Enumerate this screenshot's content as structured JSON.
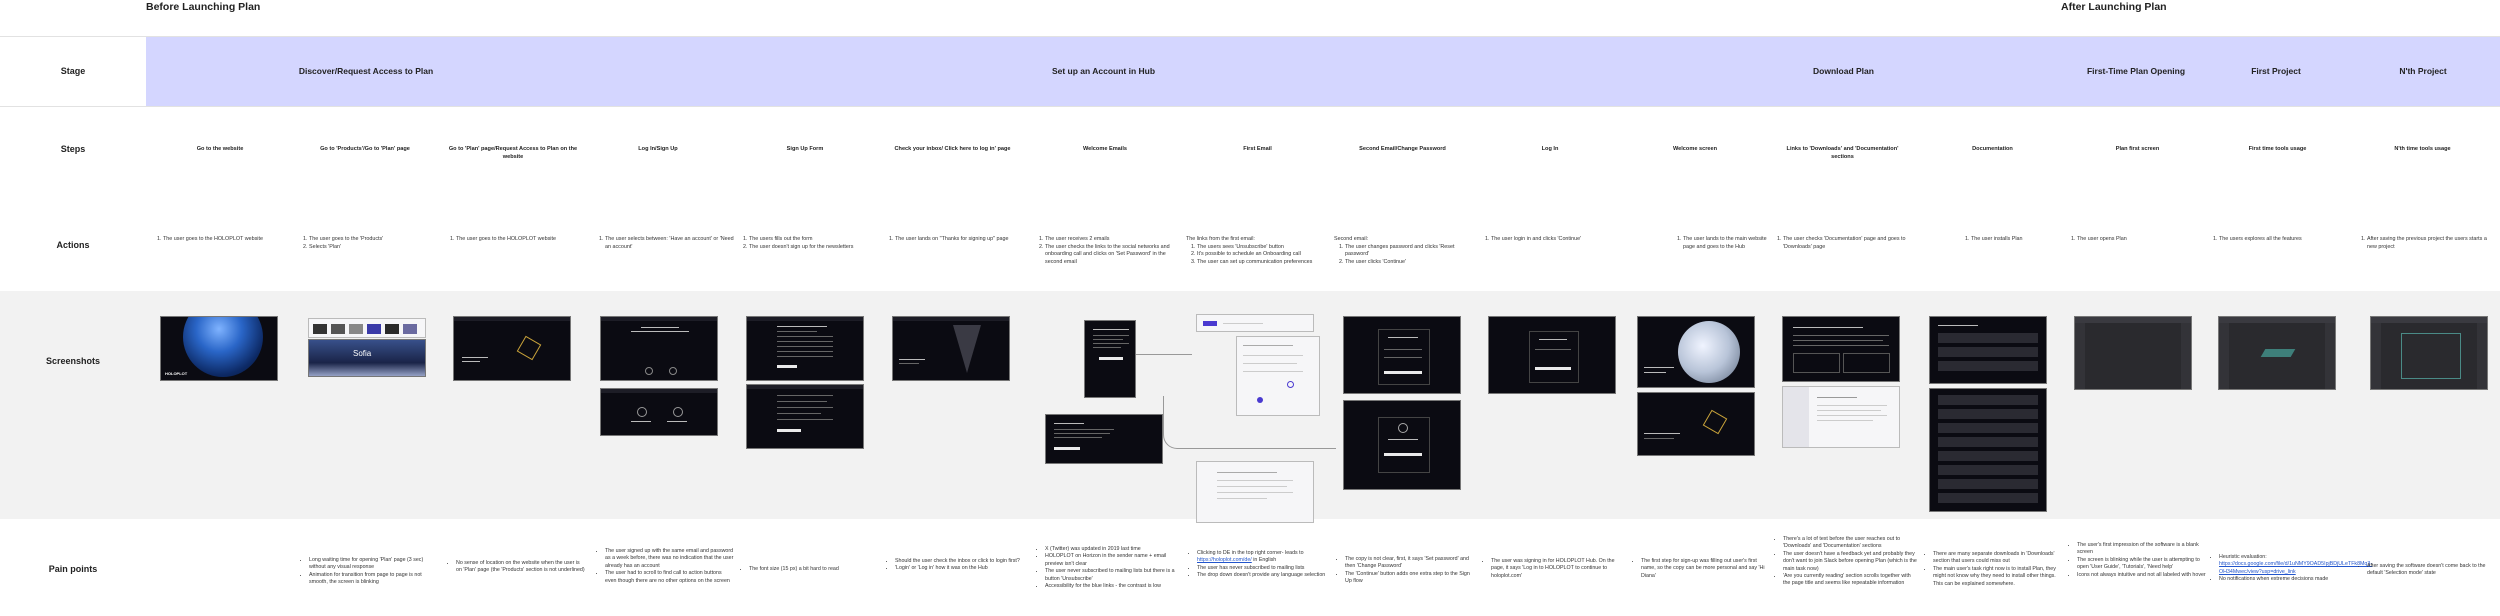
{
  "phases": {
    "before": "Before Launching Plan",
    "after": "After Launching Plan"
  },
  "row_labels": {
    "stage": "Stage",
    "steps": "Steps",
    "actions": "Actions",
    "screenshots": "Screenshots",
    "pain_points": "Pain points"
  },
  "stages": [
    "Discover/Request Access to Plan",
    "Set up an Account in Hub",
    "Download Plan",
    "First-Time Plan Opening",
    "First Project",
    "N'th Project"
  ],
  "steps": [
    "Go to the website",
    "Go to 'Products'/Go to 'Plan' page",
    "Go to 'Plan' page/Request Access to Plan on the website",
    "Log In/Sign Up",
    "Sign Up Form",
    "Check your inbox/ Click here to log in' page",
    "Welcome Emails",
    "First Email",
    "Second Email/Change Password",
    "Log In",
    "Welcome screen",
    "Links to 'Downloads' and 'Documentation' sections",
    "Documentation",
    "Plan first screen",
    "First time tools usage",
    "N'th time tools usage"
  ],
  "actions": [
    {
      "items": [
        "The user goes to the HOLOPLOT website"
      ]
    },
    {
      "items": [
        "The user goes to the 'Products'",
        "Selects 'Plan'"
      ]
    },
    {
      "items": [
        "The user goes to the HOLOPLOT website"
      ]
    },
    {
      "items": [
        "The user selects between: 'Have an account' or 'Need an account'"
      ]
    },
    {
      "items": [
        "The users fills out the form",
        "The user doesn't sign up for the newsletters"
      ]
    },
    {
      "items": [
        "The user lands on \"Thanks for signing up\" page"
      ]
    },
    {
      "items": [
        "The user receives 2 emails",
        "The user checks the links to the social networks and onboarding call and clicks on 'Set Password' in the second email"
      ]
    },
    {
      "intro": "The links from the first email:",
      "items": [
        "The users sees 'Unsubscribe' button",
        "It's possible to schedule an Onboarding call",
        "The user can set up communication preferences"
      ]
    },
    {
      "intro": "Second email:",
      "items": [
        "The user changes password and clicks 'Reset password'",
        "The user clicks 'Continue'"
      ]
    },
    {
      "items": [
        "The user login in and clicks 'Continue'"
      ]
    },
    {
      "items": [
        "The user lands to the main website page and goes to the Hub"
      ]
    },
    {
      "items": [
        "The user checks 'Documentation' page and goes to 'Downloads' page"
      ]
    },
    {
      "items": [
        "The user installs Plan"
      ]
    },
    {
      "items": [
        "The user opens Plan"
      ]
    },
    {
      "items": [
        "The users explores all the features"
      ]
    },
    {
      "items": [
        "After saving the previous project the users starts a new project"
      ]
    }
  ],
  "pain_points": [
    {
      "items": []
    },
    {
      "items": [
        "Long waiting time for opening 'Plan' page (3 sec) without any visual response",
        "Animation for transition from page to page is not smooth, the screen is blinking"
      ]
    },
    {
      "items": [
        "No sense of location on the website when the user is on 'Plan' page (the 'Products' section is not underlined)"
      ]
    },
    {
      "items": [
        "The user signed up with the same email and password as a week before, there was no indication that the user already has an account",
        "The user had to scroll to find call to action buttons even though there are no other options on the screen"
      ]
    },
    {
      "items": [
        "The font size (15 px) a bit hard to read"
      ]
    },
    {
      "items": [
        "Should the user check the inbox or click to login first?",
        "'Login' or 'Log in' how it was on the Hub"
      ]
    },
    {
      "items": [
        "X (Twitter) was updated in 2019 last time",
        "HOLOPLOT on Horizon in the sender name + email preview isn't clear",
        "The user never subscribed to mailing lists but there is a button 'Unsubscribe'",
        "Accessibility for the blue links - the contrast is low"
      ]
    },
    {
      "items": [
        "Clicking to DE in the top right corner- leads to https://holoplot.com/de/ in English",
        "The user has never subscribed to mailing lists",
        "The drop down doesn't provide any language selection"
      ],
      "link": "https://holoplot.com/de/"
    },
    {
      "items": [
        "The copy is not clear, first, it says 'Set password' and then 'Change Password'",
        "The 'Continue' button adds one extra step to the Sign Up flow"
      ]
    },
    {
      "items": [
        "The user was signing in for HOLOPLOT Hub. On the page, it says 'Log in to HOLOPLOT to continue to holoplot.com'"
      ]
    },
    {
      "items": [
        "The first step for sign-up was filling out user's first name, so the copy can be more personal and say 'Hi Diana'"
      ]
    },
    {
      "items": [
        "There's a lot of text before the user reaches out to 'Downloads' and 'Documentation' sections",
        "The user doesn't have a feedback yet and probably they don't want to join Slack before opening Plan (which is the main task now)",
        "'Are you currently reading' section scrolls together with the page title and seems like repeatable information"
      ]
    },
    {
      "items": [
        "There are many separate downloads in 'Downloads' section that users could miss out",
        "The main user's task right now is to install Plan, they might not know why they need to install other things. This can be explained somewhere."
      ]
    },
    {
      "items": [
        "The user's first impression of the software is a blank screen",
        "The screen is blinking while the user is attempting to open 'User Guide', 'Tutorials', 'Need help'",
        "Icons not always intuitive and not all labeled with hover"
      ]
    },
    {
      "items": [
        "Heuristic evaluation: https://docs.google.com/file/d/1uNMY9OAD5IpjBDjULeTFk8Mq3-OH34Mwec/view?usp=drive_link",
        "No notifications when extreme decisions made"
      ],
      "link": "https://docs.google.com/file/d/1uNMY9OAD5IpjBDjULeTFk8Mq3-OH34Mwec/view?usp=drive_link"
    },
    {
      "items": [
        "After saving the software doesn't come back to the default 'Selection mode' state"
      ]
    }
  ],
  "screens": {
    "brand_word": "HOLOPLOT",
    "sofia_word": "Sofia"
  },
  "colors": {
    "stage_band": "#d4d6ff",
    "screenshot_band": "#f2f2f2",
    "link": "#2255cc"
  }
}
